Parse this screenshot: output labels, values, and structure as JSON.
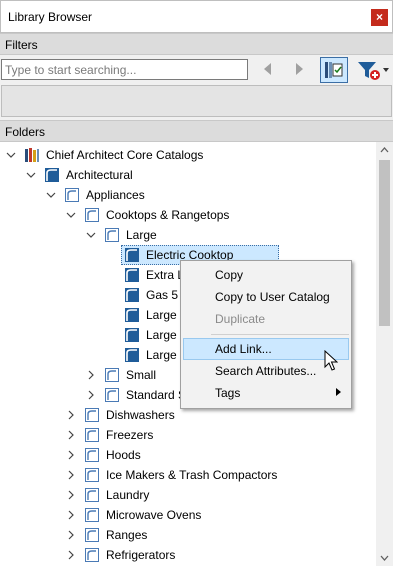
{
  "window": {
    "title": "Library Browser",
    "close_glyph": "×"
  },
  "filters": {
    "header": "Filters",
    "search_placeholder": "Type to start searching..."
  },
  "folders": {
    "header": "Folders",
    "items": [
      {
        "label": "Chief Architect Core Catalogs"
      },
      {
        "label": "Architectural"
      },
      {
        "label": "Appliances"
      },
      {
        "label": "Cooktops & Rangetops"
      },
      {
        "label": "Large"
      },
      {
        "label": "Electric Cooktop"
      },
      {
        "label": "Extra L"
      },
      {
        "label": "Gas 5 B"
      },
      {
        "label": "Large I"
      },
      {
        "label": "Large G"
      },
      {
        "label": "Large I"
      },
      {
        "label": "Small"
      },
      {
        "label": "Standard S"
      },
      {
        "label": "Dishwashers"
      },
      {
        "label": "Freezers"
      },
      {
        "label": "Hoods"
      },
      {
        "label": "Ice Makers & Trash Compactors"
      },
      {
        "label": "Laundry"
      },
      {
        "label": "Microwave Ovens"
      },
      {
        "label": "Ranges"
      },
      {
        "label": "Refrigerators"
      }
    ]
  },
  "context_menu": {
    "items": [
      {
        "label": "Copy"
      },
      {
        "label": "Copy to User Catalog"
      },
      {
        "label": "Duplicate"
      },
      {
        "label": "Add Link..."
      },
      {
        "label": "Search Attributes..."
      },
      {
        "label": "Tags"
      }
    ]
  },
  "colors": {
    "accent": "#1f5c99",
    "selection": "#cce8ff",
    "close_red": "#c42b1c"
  }
}
